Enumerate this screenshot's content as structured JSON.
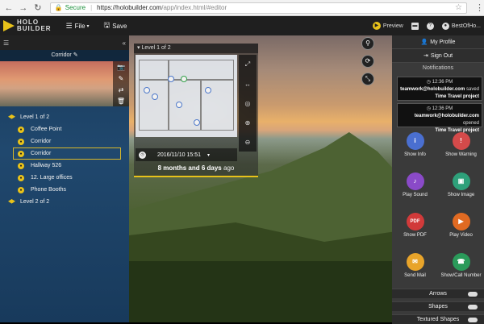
{
  "browser": {
    "back_icon": "back-icon",
    "forward_icon": "forward-icon",
    "reload_icon": "reload-icon",
    "secure_label": "Secure",
    "url_host": "https://holobuilder.com",
    "url_path": "/app/index.html/#editor"
  },
  "header": {
    "logo_line1": "HOLO",
    "logo_line2": "BUILDER",
    "file_label": "File",
    "save_label": "Save",
    "preview_label": "Preview",
    "user_label": "BestOfHo..."
  },
  "sidebar": {
    "scene_title": "Corridor",
    "tree": [
      {
        "kind": "level",
        "label": "Level 1 of 2"
      },
      {
        "kind": "room",
        "label": "Coffee Point"
      },
      {
        "kind": "room",
        "label": "Corridor"
      },
      {
        "kind": "room",
        "label": "Corridor",
        "selected": true
      },
      {
        "kind": "room",
        "label": "Hallway 526"
      },
      {
        "kind": "room",
        "label": "12. Large offices"
      },
      {
        "kind": "room",
        "label": "Phone Booths"
      },
      {
        "kind": "level",
        "label": "Level 2 of 2"
      }
    ]
  },
  "floorplan": {
    "level_label": "Level 1 of 2",
    "timestamp": "2016/11/10 15:51",
    "ago_strong": "8 months and 6 days",
    "ago_suffix": "ago"
  },
  "right_panel": {
    "profile_label": "My Profile",
    "signout_label": "Sign Out",
    "notifications_title": "Notifications",
    "notifications": [
      {
        "time": "12:36 PM",
        "user": "teamwork@holobuilder.com",
        "action": "saved",
        "project": "Time Travel project"
      },
      {
        "time": "12:36 PM",
        "user": "teamwork@holobuilder.com",
        "action": "opened",
        "project": "Time Travel project"
      }
    ],
    "actions": [
      {
        "label": "Show Info",
        "color": "#4a6fd0",
        "glyph": "i"
      },
      {
        "label": "Show Warning",
        "color": "#d44a4a",
        "glyph": "!"
      },
      {
        "label": "Play Sound",
        "color": "#8a4ac8",
        "glyph": "♪"
      },
      {
        "label": "Show Image",
        "color": "#2ea07a",
        "glyph": "▣"
      },
      {
        "label": "Show PDF",
        "color": "#d13a3a",
        "glyph": "PDF"
      },
      {
        "label": "Play Video",
        "color": "#e06a22",
        "glyph": "▶"
      },
      {
        "label": "Send Mail",
        "color": "#e8a42a",
        "glyph": "✉"
      },
      {
        "label": "Show/Call Number",
        "color": "#2a9a5a",
        "glyph": "☎"
      }
    ],
    "sections": [
      "Arrows",
      "Shapes",
      "Textured Shapes"
    ]
  },
  "colors": {
    "accent": "#e8c21a",
    "header_bg": "#1f1f1f",
    "panel_bg": "#3a3a3a"
  }
}
